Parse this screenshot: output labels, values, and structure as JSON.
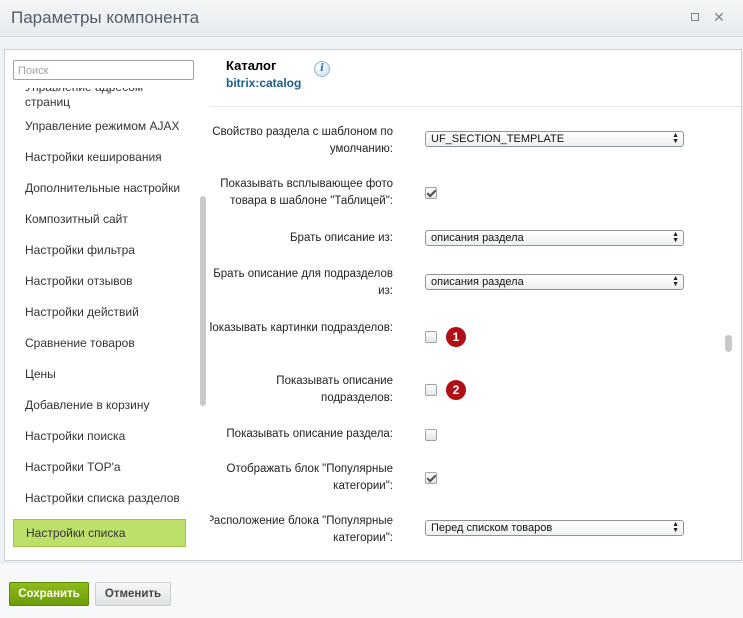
{
  "window": {
    "title": "Параметры компонента"
  },
  "sidebar": {
    "search_placeholder": "Поиск",
    "items": [
      {
        "label": "Управление адресом страниц",
        "partial": true
      },
      {
        "label": "Управление режимом AJAX"
      },
      {
        "label": "Настройки кеширования"
      },
      {
        "label": "Дополнительные настройки"
      },
      {
        "label": "Композитный сайт"
      },
      {
        "label": "Настройки фильтра"
      },
      {
        "label": "Настройки отзывов"
      },
      {
        "label": "Настройки действий"
      },
      {
        "label": "Сравнение товаров"
      },
      {
        "label": "Цены"
      },
      {
        "label": "Добавление в корзину"
      },
      {
        "label": "Настройки поиска"
      },
      {
        "label": "Настройки TOP'a"
      },
      {
        "label": "Настройки списка разделов"
      },
      {
        "label": "Настройки списка",
        "active": true
      }
    ]
  },
  "component": {
    "name": "Каталог",
    "id": "bitrix:catalog"
  },
  "form": {
    "rows": [
      {
        "label": "Свойство раздела с шаблоном по умолчанию:",
        "type": "select",
        "value": "UF_SECTION_TEMPLATE"
      },
      {
        "label": "Показывать всплывающее фото товара в шаблоне \"Таблицей\":",
        "type": "checkbox",
        "checked": true
      },
      {
        "label": "Брать описание из:",
        "type": "select",
        "value": "описания раздела"
      },
      {
        "label": "Брать описание для подразделов из:",
        "type": "select",
        "value": "описания раздела"
      },
      {
        "label": "Показывать картинки подразделов:",
        "type": "checkbox",
        "checked": false,
        "badge": "1"
      },
      {
        "label": "Показывать описание подразделов:",
        "type": "checkbox",
        "checked": false,
        "badge": "2"
      },
      {
        "label": "Показывать описание раздела:",
        "type": "checkbox",
        "checked": false
      },
      {
        "label": "Отображать блок \"Популярные категории\":",
        "type": "checkbox",
        "checked": true
      },
      {
        "label": "Расположение блока \"Популярные категории\":",
        "type": "select",
        "value": "Перед списком товаров"
      }
    ]
  },
  "footer": {
    "save_label": "Сохранить",
    "cancel_label": "Отменить"
  },
  "colors": {
    "accent_green": "#7aa90d",
    "active_item": "#bde06b",
    "badge_red": "#b00f16",
    "link_blue": "#1c5d8b"
  }
}
